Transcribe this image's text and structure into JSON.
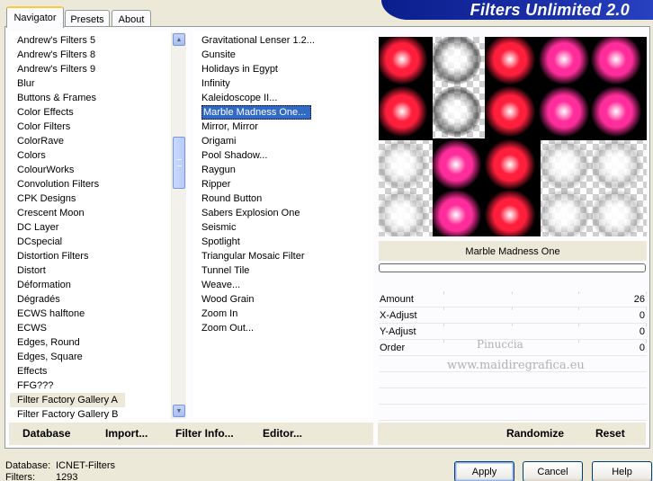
{
  "tabs": [
    {
      "label": "Navigator",
      "active": true
    },
    {
      "label": "Presets",
      "active": false
    },
    {
      "label": "About",
      "active": false
    }
  ],
  "banner": {
    "title": "Filters Unlimited 2.0"
  },
  "categories": [
    {
      "label": "Andrew's Filters 5"
    },
    {
      "label": "Andrew's Filters 8"
    },
    {
      "label": "Andrew's Filters 9"
    },
    {
      "label": "Blur"
    },
    {
      "label": "Buttons & Frames"
    },
    {
      "label": "Color Effects"
    },
    {
      "label": "Color Filters"
    },
    {
      "label": "ColorRave"
    },
    {
      "label": "Colors"
    },
    {
      "label": "ColourWorks"
    },
    {
      "label": "Convolution Filters"
    },
    {
      "label": "CPK Designs"
    },
    {
      "label": "Crescent Moon"
    },
    {
      "label": "DC Layer"
    },
    {
      "label": "DCspecial"
    },
    {
      "label": "Distortion Filters"
    },
    {
      "label": "Distort"
    },
    {
      "label": "Déformation"
    },
    {
      "label": "Dégradés"
    },
    {
      "label": "ECWS halftone"
    },
    {
      "label": "ECWS"
    },
    {
      "label": "Edges, Round"
    },
    {
      "label": "Edges, Square"
    },
    {
      "label": "Effects"
    },
    {
      "label": "FFG???"
    },
    {
      "label": "Filter Factory Gallery A",
      "highlighted": true
    },
    {
      "label": "Filter Factory Gallery B"
    }
  ],
  "filters": [
    {
      "label": "Gravitational Lenser 1.2..."
    },
    {
      "label": "Gunsite"
    },
    {
      "label": "Holidays in Egypt"
    },
    {
      "label": "Infinity"
    },
    {
      "label": "Kaleidoscope II..."
    },
    {
      "label": "Marble Madness One...",
      "selected": true
    },
    {
      "label": "Mirror, Mirror"
    },
    {
      "label": "Origami"
    },
    {
      "label": "Pool Shadow..."
    },
    {
      "label": "Raygun"
    },
    {
      "label": "Ripper"
    },
    {
      "label": "Round Button"
    },
    {
      "label": "Sabers Explosion One"
    },
    {
      "label": "Seismic"
    },
    {
      "label": "Spotlight"
    },
    {
      "label": "Triangular Mosaic Filter"
    },
    {
      "label": "Tunnel Tile"
    },
    {
      "label": "Weave..."
    },
    {
      "label": "Wood Grain"
    },
    {
      "label": "Zoom In"
    },
    {
      "label": "Zoom Out..."
    }
  ],
  "left_actions": {
    "database": "Database",
    "import": "Import...",
    "filter_info": "Filter Info...",
    "editor": "Editor..."
  },
  "right_actions": {
    "randomize": "Randomize",
    "reset": "Reset"
  },
  "preview": {
    "filter_name": "Marble Madness One",
    "progress": 0
  },
  "params": [
    {
      "label": "Amount",
      "value": "26"
    },
    {
      "label": "X-Adjust",
      "value": "0"
    },
    {
      "label": "Y-Adjust",
      "value": "0"
    },
    {
      "label": "Order",
      "value": "0"
    }
  ],
  "watermark": {
    "line1": "Pinuccia",
    "line2": "www.maidiregrafica.eu"
  },
  "status": {
    "database_label": "Database:",
    "database_value": "ICNET-Filters",
    "filters_label": "Filters:",
    "filters_value": "1293"
  },
  "buttons": {
    "apply": "Apply",
    "cancel": "Cancel",
    "help": "Help"
  },
  "colors": {
    "selection": "#316ac5",
    "banner": "#0a1e8c",
    "blob_red": "#ff1e3c",
    "blob_pink": "#ff2d9b"
  }
}
